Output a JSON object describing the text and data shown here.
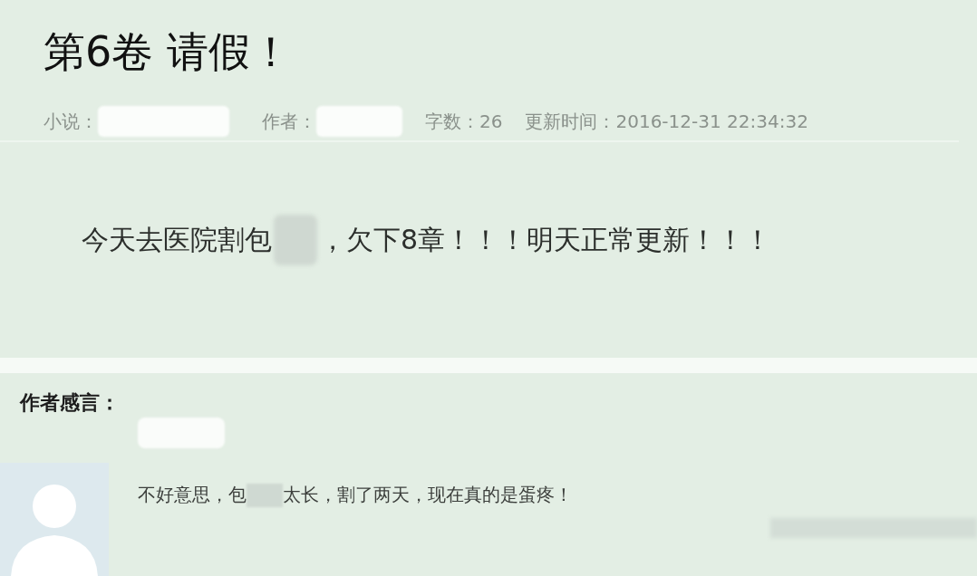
{
  "chapter": {
    "title": "第6卷 请假！",
    "meta": [
      {
        "kind": "redacted",
        "label": "小说："
      },
      {
        "kind": "redacted",
        "label": "作者："
      },
      {
        "kind": "text",
        "label": "字数：",
        "value": "26"
      },
      {
        "kind": "text",
        "label": "更新时间：",
        "value": "2016-12-31 22:34:32"
      }
    ],
    "body": {
      "text_before": "今天去医院割包",
      "text_after": "，欠下8章！！！明天正常更新！！！"
    }
  },
  "author_note": {
    "heading": "作者感言：",
    "comment": {
      "text_before": "不好意思，包",
      "text_after": "太长，割了两天，现在真的是蛋疼！"
    }
  }
}
